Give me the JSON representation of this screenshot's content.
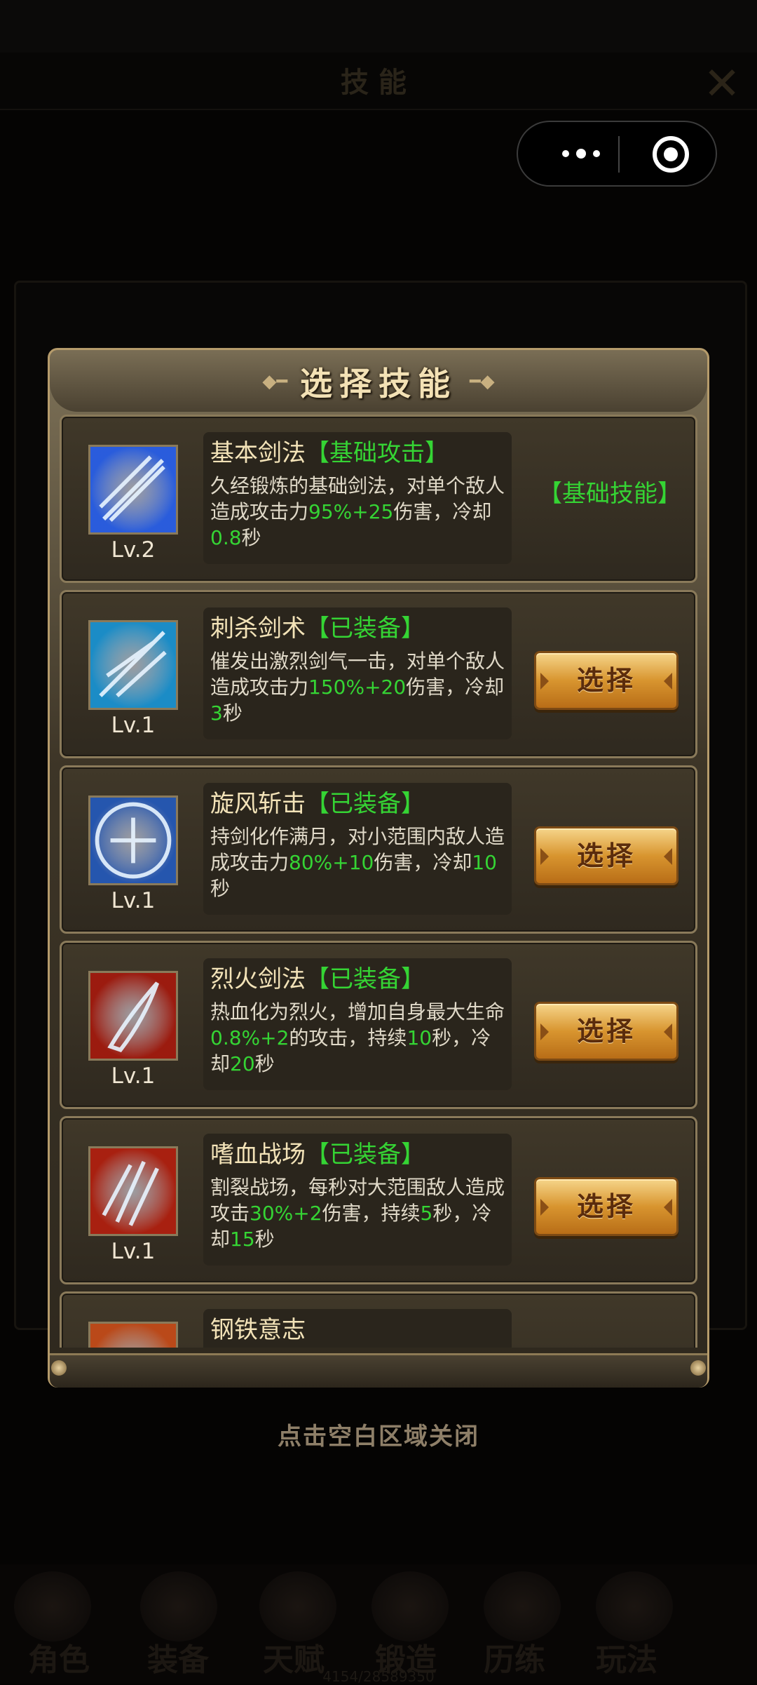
{
  "background": {
    "title": "技能",
    "nav": [
      "角色",
      "装备",
      "天赋",
      "锻造",
      "历练",
      "玩法"
    ],
    "footer_number": "4154/28589350"
  },
  "capsule": {
    "more_icon": "more-dots-icon",
    "close_icon": "target-circle-icon"
  },
  "dialog": {
    "title": "选择技能",
    "skills": [
      {
        "name": "基本剑法",
        "tag": "【基础攻击】",
        "level": "Lv.2",
        "desc": [
          {
            "t": "久经锻炼的基础剑法，对单个敌人造成攻击力"
          },
          {
            "t": "95%+25",
            "g": true
          },
          {
            "t": "伤害，冷却"
          },
          {
            "t": "0.8",
            "g": true
          },
          {
            "t": "秒"
          }
        ],
        "action_label": "【基础技能】",
        "action_type": "label",
        "icon_color": "#2f6bff"
      },
      {
        "name": "刺杀剑术",
        "tag": "【已装备】",
        "level": "Lv.1",
        "desc": [
          {
            "t": "催发出激烈剑气一击，对单个敌人造成攻击力"
          },
          {
            "t": "150%+20",
            "g": true
          },
          {
            "t": "伤害，冷却"
          },
          {
            "t": "3",
            "g": true
          },
          {
            "t": "秒"
          }
        ],
        "action_label": "选择",
        "action_type": "button",
        "icon_color": "#1ea3e6"
      },
      {
        "name": "旋风斩击",
        "tag": "【已装备】",
        "level": "Lv.1",
        "desc": [
          {
            "t": "持剑化作满月，对小范围内敌人造成攻击力"
          },
          {
            "t": "80%+10",
            "g": true
          },
          {
            "t": "伤害，冷却"
          },
          {
            "t": "10",
            "g": true
          },
          {
            "t": "秒"
          }
        ],
        "action_label": "选择",
        "action_type": "button",
        "icon_color": "#2a63c9"
      },
      {
        "name": "烈火剑法",
        "tag": "【已装备】",
        "level": "Lv.1",
        "desc": [
          {
            "t": "热血化为烈火，增加自身最大生命"
          },
          {
            "t": "0.8%+2",
            "g": true
          },
          {
            "t": "的攻击，持续"
          },
          {
            "t": "10",
            "g": true
          },
          {
            "t": "秒，冷却"
          },
          {
            "t": "20",
            "g": true
          },
          {
            "t": "秒"
          }
        ],
        "action_label": "选择",
        "action_type": "button",
        "icon_color": "#b51e0e"
      },
      {
        "name": "嗜血战场",
        "tag": "【已装备】",
        "level": "Lv.1",
        "desc": [
          {
            "t": "割裂战场，每秒对大范围敌人造成攻击"
          },
          {
            "t": "30%+2",
            "g": true
          },
          {
            "t": "伤害，持续"
          },
          {
            "t": "5",
            "g": true
          },
          {
            "t": "秒，冷却"
          },
          {
            "t": "15",
            "g": true
          },
          {
            "t": "秒"
          }
        ],
        "action_label": "选择",
        "action_type": "button",
        "icon_color": "#c4240f"
      },
      {
        "name": "钢铁意志",
        "tag": "",
        "level": "",
        "desc": [],
        "action_label": "",
        "action_type": "button",
        "icon_color": "#d9541a"
      }
    ]
  },
  "close_hint": "点击空白区域关闭"
}
